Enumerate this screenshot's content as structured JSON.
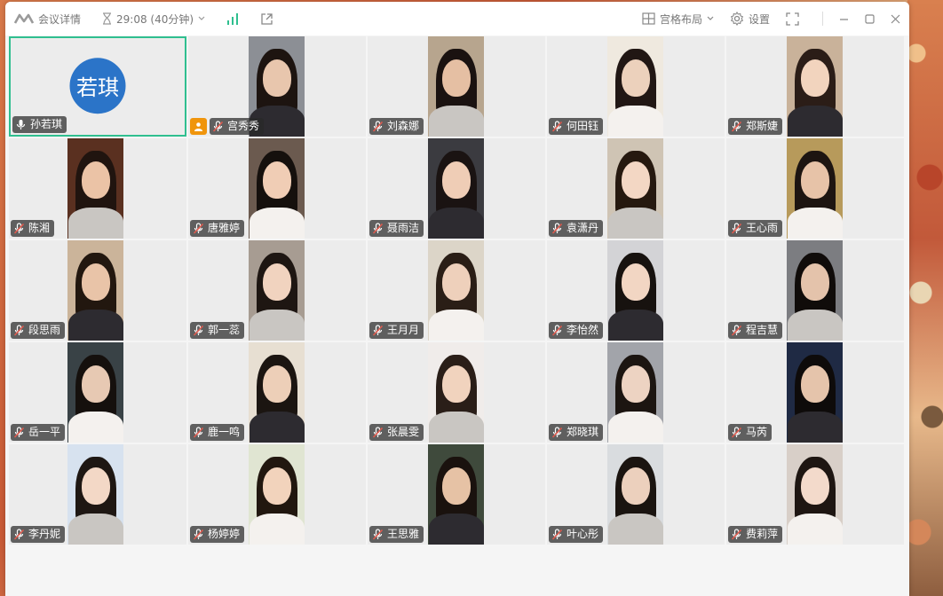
{
  "titlebar": {
    "meeting_details": "会议详情",
    "timer": "29:08 (40分钟)",
    "layout_label": "宫格布局",
    "settings_label": "设置"
  },
  "participants": [
    {
      "name": "孙若琪",
      "avatar_text": "若琪",
      "mic": "on",
      "active": true
    },
    {
      "name": "宫秀秀",
      "mic": "muted",
      "host": true
    },
    {
      "name": "刘森娜",
      "mic": "muted"
    },
    {
      "name": "何田钰",
      "mic": "muted"
    },
    {
      "name": "郑斯婕",
      "mic": "muted"
    },
    {
      "name": "陈湘",
      "mic": "muted"
    },
    {
      "name": "唐雅婷",
      "mic": "muted"
    },
    {
      "name": "聂雨洁",
      "mic": "muted"
    },
    {
      "name": "袁潇丹",
      "mic": "muted"
    },
    {
      "name": "王心雨",
      "mic": "muted"
    },
    {
      "name": "段思雨",
      "mic": "muted"
    },
    {
      "name": "郭一蕊",
      "mic": "muted"
    },
    {
      "name": "王月月",
      "mic": "muted"
    },
    {
      "name": "李怡然",
      "mic": "muted"
    },
    {
      "name": "程吉慧",
      "mic": "muted"
    },
    {
      "name": "岳一平",
      "mic": "muted"
    },
    {
      "name": "鹿一鸣",
      "mic": "muted"
    },
    {
      "name": "张晨雯",
      "mic": "muted"
    },
    {
      "name": "郑晓琪",
      "mic": "muted"
    },
    {
      "name": "马芮",
      "mic": "muted"
    },
    {
      "name": "李丹妮",
      "mic": "muted"
    },
    {
      "name": "杨婷婷",
      "mic": "muted"
    },
    {
      "name": "王思雅",
      "mic": "muted"
    },
    {
      "name": "叶心彤",
      "mic": "muted"
    },
    {
      "name": "费莉萍",
      "mic": "muted"
    }
  ],
  "colors": {
    "active_border": "#2fbf8f",
    "avatar_bg": "#2b74c8",
    "host_badge": "#f0950c",
    "muted_icon": "#e05a4e"
  }
}
